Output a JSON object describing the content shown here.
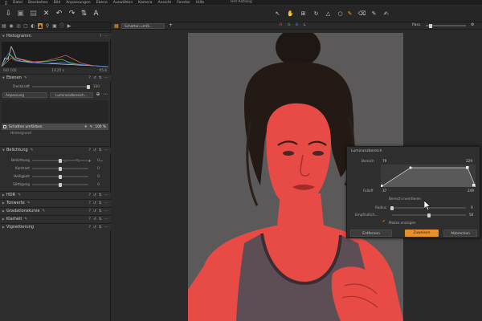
{
  "window": {
    "title": "Test-Katalog"
  },
  "menu": [
    "Datei",
    "Bearbeiten",
    "Bild",
    "Anpassungen",
    "Ebene",
    "Auswählen",
    "Kamera",
    "Ansicht",
    "Fenster",
    "Hilfe"
  ],
  "viewer": {
    "variant_name": "Schatten umfä...",
    "zoom_label": "Pass.",
    "channels": [
      "R",
      "G",
      "B",
      "L"
    ],
    "channel_colors": [
      "#e05050",
      "#60c060",
      "#5080e0",
      "#bbbbbb"
    ]
  },
  "histogram": {
    "title": "Histogramm",
    "iso": "ISO 100",
    "shutter": "1/125 s",
    "aperture": "f/5.6"
  },
  "layers": {
    "title": "Ebenen",
    "opacity_label": "Deckkraft",
    "opacity_value": "100",
    "opacity_level": 1.0,
    "adjust_dropdown": "Anpassung",
    "luminance_button": "Luminanzbereich...",
    "selected_layer": "Schatten umfärben",
    "selected_layer_opacity": "100 %",
    "background_layer": "Hintergrund"
  },
  "exposure": {
    "title": "Belichtung",
    "sliders": [
      {
        "label": "Belichtung",
        "value": "0",
        "level": 0.5
      },
      {
        "label": "Kontrast",
        "value": "0",
        "level": 0.5
      },
      {
        "label": "Helligkeit",
        "value": "0",
        "level": 0.5
      },
      {
        "label": "Sättigung",
        "value": "0",
        "level": 0.5
      }
    ]
  },
  "tools": [
    {
      "title": "HDR"
    },
    {
      "title": "Tonwerte"
    },
    {
      "title": "Gradationskurve"
    },
    {
      "title": "Klarheit"
    },
    {
      "title": "Vignettierung"
    }
  ],
  "luminance_dialog": {
    "title": "Luminanzbereich",
    "range_label": "Bereich",
    "range_low": "79",
    "range_high": "229",
    "falloff_label": "Falloff",
    "falloff_low": "37",
    "falloff_high": "249",
    "invert_label": "Bereich invertieren",
    "radius_label": "Radius",
    "radius_value": "0",
    "radius_level": 0.0,
    "sensitivity_label": "Empfindlich...",
    "sensitivity_value": "50",
    "sensitivity_level": 0.5,
    "mask_label": "Maske anzeigen",
    "mask_checked": true,
    "reset_label": "Entfernen",
    "confirm_label": "Zuweisen",
    "cancel_label": "Abbrechen",
    "accent": "#e8902a"
  },
  "mask_color": "#e84a45"
}
